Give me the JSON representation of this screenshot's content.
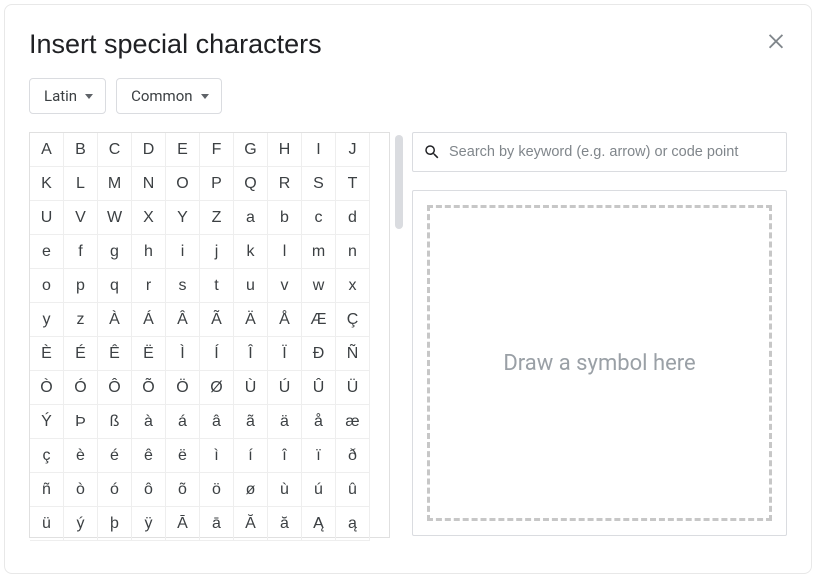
{
  "title": "Insert special characters",
  "dropdowns": {
    "script": "Latin",
    "category": "Common"
  },
  "search": {
    "placeholder": "Search by keyword (e.g. arrow) or code point",
    "value": ""
  },
  "draw": {
    "placeholder": "Draw a symbol here"
  },
  "chars": [
    "A",
    "B",
    "C",
    "D",
    "E",
    "F",
    "G",
    "H",
    "I",
    "J",
    "K",
    "L",
    "M",
    "N",
    "O",
    "P",
    "Q",
    "R",
    "S",
    "T",
    "U",
    "V",
    "W",
    "X",
    "Y",
    "Z",
    "a",
    "b",
    "c",
    "d",
    "e",
    "f",
    "g",
    "h",
    "i",
    "j",
    "k",
    "l",
    "m",
    "n",
    "o",
    "p",
    "q",
    "r",
    "s",
    "t",
    "u",
    "v",
    "w",
    "x",
    "y",
    "z",
    "À",
    "Á",
    "Â",
    "Ã",
    "Ä",
    "Å",
    "Æ",
    "Ç",
    "È",
    "É",
    "Ê",
    "Ë",
    "Ì",
    "Í",
    "Î",
    "Ï",
    "Đ",
    "Ñ",
    "Ò",
    "Ó",
    "Ô",
    "Õ",
    "Ö",
    "Ø",
    "Ù",
    "Ú",
    "Û",
    "Ü",
    "Ý",
    "Þ",
    "ß",
    "à",
    "á",
    "â",
    "ã",
    "ä",
    "å",
    "æ",
    "ç",
    "è",
    "é",
    "ê",
    "ë",
    "ì",
    "í",
    "î",
    "ï",
    "ð",
    "ñ",
    "ò",
    "ó",
    "ô",
    "õ",
    "ö",
    "ø",
    "ù",
    "ú",
    "û",
    "ü",
    "ý",
    "þ",
    "ÿ",
    "Ā",
    "ā",
    "Ă",
    "ă",
    "Ą",
    "ą"
  ]
}
